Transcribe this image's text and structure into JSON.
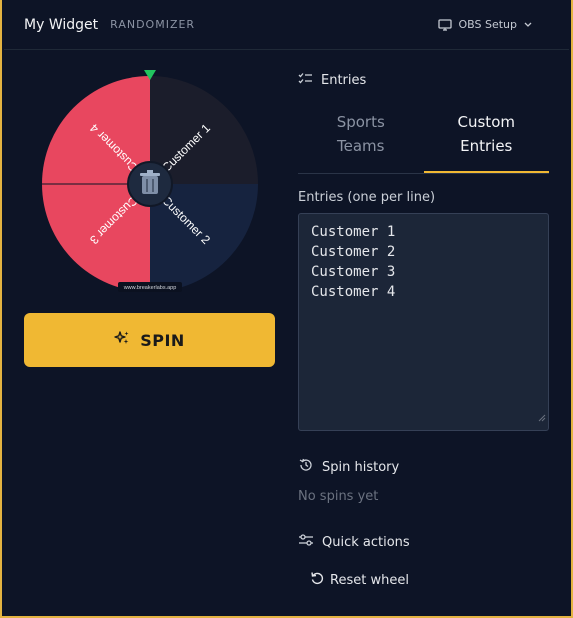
{
  "header": {
    "title": "My Widget",
    "subtitle": "RANDOMIZER",
    "obs_label": "OBS Setup",
    "monitor_icon": "monitor-icon",
    "chevron_icon": "chevron-down-icon"
  },
  "wheel": {
    "watermark": "www.breakerlabs.app",
    "center_icon": "trash-can-icon",
    "pointer_color": "#22c55e",
    "segments": [
      {
        "label": "Customer 1",
        "color": "#1b1d2b"
      },
      {
        "label": "Customer 2",
        "color": "#16233f"
      },
      {
        "label": "Customer 3",
        "color": "#e8475f"
      },
      {
        "label": "Customer 4",
        "color": "#e8475f"
      }
    ]
  },
  "spin_button": {
    "label": "SPIN",
    "icon": "sparkle-icon",
    "color": "#f0b833"
  },
  "entries": {
    "heading": "Entries",
    "heading_icon": "checklist-icon",
    "tabs": [
      {
        "label_line1": "Sports",
        "label_line2": "Teams",
        "active": false
      },
      {
        "label_line1": "Custom",
        "label_line2": "Entries",
        "active": true
      }
    ],
    "field_label": "Entries (one per line)",
    "lines": [
      "Customer 1",
      "Customer 2",
      "Customer 3",
      "Customer 4"
    ]
  },
  "history": {
    "heading": "Spin history",
    "icon": "history-icon",
    "empty_text": "No spins yet"
  },
  "quick_actions": {
    "heading": "Quick actions",
    "icon": "sliders-icon",
    "reset_label": "Reset wheel",
    "reset_icon": "reset-icon"
  },
  "accent_color": "#f0b833"
}
